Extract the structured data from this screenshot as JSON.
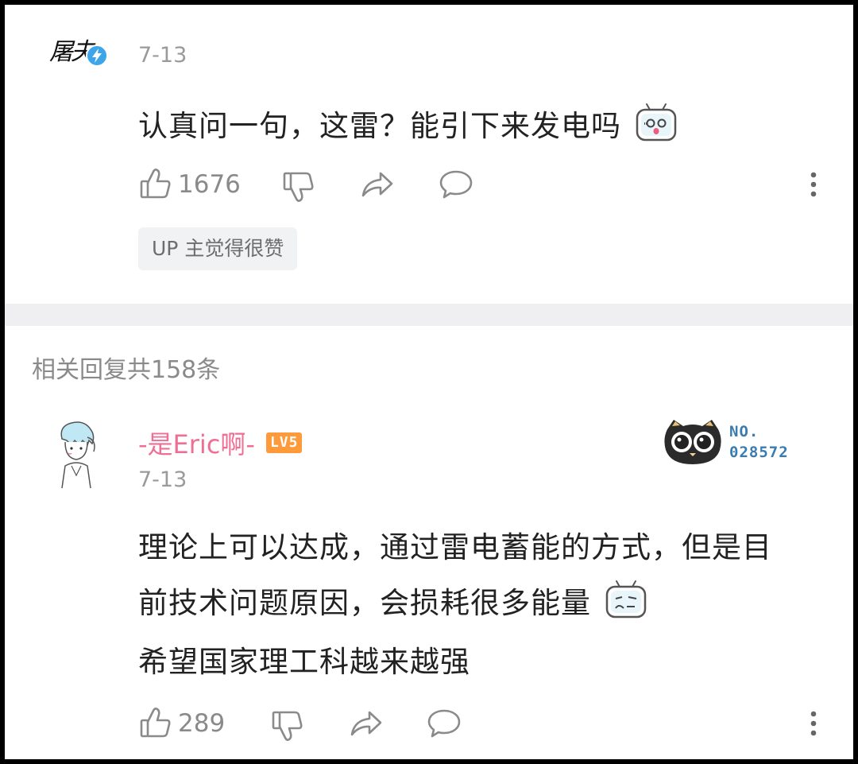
{
  "comment_main": {
    "avatar_text": "屠夫",
    "date": "7-13",
    "content": "认真问一句，这雷？能引下来发电吗",
    "emoji": "surprised-tv-emoji",
    "like_count": "1676",
    "up_tag": "UP 主觉得很赞"
  },
  "replies": {
    "header": "相关回复共158条"
  },
  "reply_1": {
    "username": "-是Eric啊-",
    "level": "LV5",
    "date": "7-13",
    "content_line1": "理论上可以达成，通过雷电蓄能的方式，但是目",
    "content_line2": "前技术问题原因，会损耗很多能量",
    "content_line3": "希望国家理工科越来越强",
    "fan_badge_label": "NO.",
    "fan_badge_number": "028572",
    "like_count": "289"
  },
  "colors": {
    "username": "#ee6f93",
    "level_badge": "#ff9a3a",
    "divider": "#efeff1",
    "verified": "#3ea6e8"
  },
  "icons": [
    "thumb-up-icon",
    "thumb-down-icon",
    "share-icon",
    "comment-icon",
    "more-icon",
    "verified-icon"
  ]
}
